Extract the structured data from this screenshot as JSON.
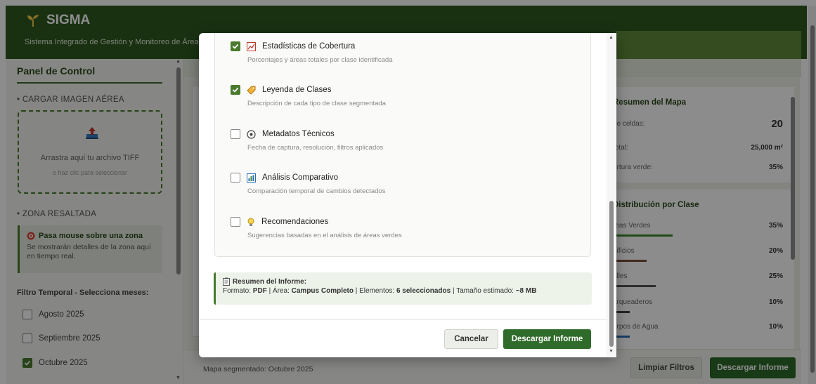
{
  "header": {
    "title": "SIGMA",
    "subtitle": "Sistema Integrado de Gestión y Monitoreo de Áreas"
  },
  "sidebar": {
    "title": "Panel de Control",
    "upload_section": "• CARGAR IMAGEN AÉREA",
    "upload_main": "Arrastra aquí tu archivo TIFF",
    "upload_sub": "o haz clic para seleccionar",
    "zone_section": "• ZONA RESALTADA",
    "zone_title": "Pasa mouse sobre una zona",
    "zone_text": "Se mostrarán detalles de la zona aquí en tiempo real.",
    "filter_label": "Filtro Temporal - Selecciona meses:",
    "months": [
      {
        "label": "Agosto 2025",
        "checked": false
      },
      {
        "label": "Septiembre 2025",
        "checked": false
      },
      {
        "label": "Octubre 2025",
        "checked": true
      }
    ]
  },
  "main": {
    "status": "Mapa segmentado: Octubre 2025"
  },
  "right_panel": {
    "summary_title": "Resumen del Mapa",
    "summary_rows": [
      {
        "label": "de celdas:",
        "value": "20"
      },
      {
        "label": "total:",
        "value": "25,000 m²"
      },
      {
        "label": "ertura verde:",
        "value": "35%"
      }
    ],
    "dist_title": "Distribución por Clase",
    "dist_rows": [
      {
        "label": "reas Verdes",
        "value": "35%",
        "percent": 35,
        "color": "#3d8b2f"
      },
      {
        "label": "dificios",
        "value": "20%",
        "percent": 20,
        "color": "#7a4b3a"
      },
      {
        "label": "alles",
        "value": "25%",
        "percent": 25,
        "color": "#555555"
      },
      {
        "label": "arqueaderos",
        "value": "10%",
        "percent": 10,
        "color": "#444444"
      },
      {
        "label": "erpos de Agua",
        "value": "10%",
        "percent": 10,
        "color": "#2a6db5"
      }
    ],
    "clear_button": "Limpiar Filtros",
    "download_button": "Descargar Informe"
  },
  "modal": {
    "options": [
      {
        "label": "Estadísticas de Cobertura",
        "desc": "Porcentajes y áreas totales por clase identificada",
        "checked": true,
        "icon": "chart-line-icon"
      },
      {
        "label": "Leyenda de Clases",
        "desc": "Descripción de cada tipo de clase segmentada",
        "checked": true,
        "icon": "tag-icon"
      },
      {
        "label": "Metadatos Técnicos",
        "desc": "Fecha de captura, resolución, filtros aplicados",
        "checked": false,
        "icon": "gear-icon"
      },
      {
        "label": "Análisis Comparativo",
        "desc": "Comparación temporal de cambios detectados",
        "checked": false,
        "icon": "bar-chart-icon"
      },
      {
        "label": "Recomendaciones",
        "desc": "Sugerencias basadas en el análisis de áreas verdes",
        "checked": false,
        "icon": "lightbulb-icon"
      }
    ],
    "summary_title": "Resumen del Informe:",
    "summary_format_label": "Formato:",
    "summary_format": "PDF",
    "summary_area_label": "Área:",
    "summary_area": "Campus Completo",
    "summary_elements_label": "Elementos:",
    "summary_elements": "6 seleccionados",
    "summary_size_label": "Tamaño estimado:",
    "summary_size": "~8 MB",
    "cancel_button": "Cancelar",
    "download_button": "Descargar Informe"
  },
  "colors": {
    "brand": "#2f5a1f",
    "accent": "#4a7a2e",
    "button": "#2f6b2a"
  }
}
